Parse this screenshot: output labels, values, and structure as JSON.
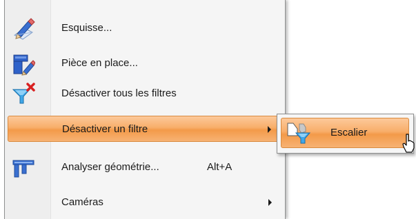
{
  "menu": {
    "items": [
      {
        "label": "Esquisse...",
        "icon": "sketch-pencil-icon"
      },
      {
        "label": "Pièce en place...",
        "icon": "part-in-place-icon"
      },
      {
        "label": "Désactiver tous les filtres",
        "icon": "funnel-red-x-icon"
      },
      {
        "label": "Désactiver un filtre",
        "icon": "funnel-icon",
        "highlighted": true,
        "has_submenu": true
      },
      {
        "label": "Analyser géométrie...",
        "shortcut": "Alt+A",
        "icon": "caliper-icon"
      },
      {
        "label": "Caméras",
        "icon": "",
        "has_submenu": true
      }
    ]
  },
  "submenu": {
    "items": [
      {
        "label": "Escalier",
        "icon": "shape-filter-icon",
        "highlighted": true
      }
    ]
  },
  "colors": {
    "highlight_top": "#fcc99a",
    "highlight_mid": "#f39a49",
    "menu_bg": "#f5f5f5",
    "gutter_bg": "#eeeeee"
  }
}
